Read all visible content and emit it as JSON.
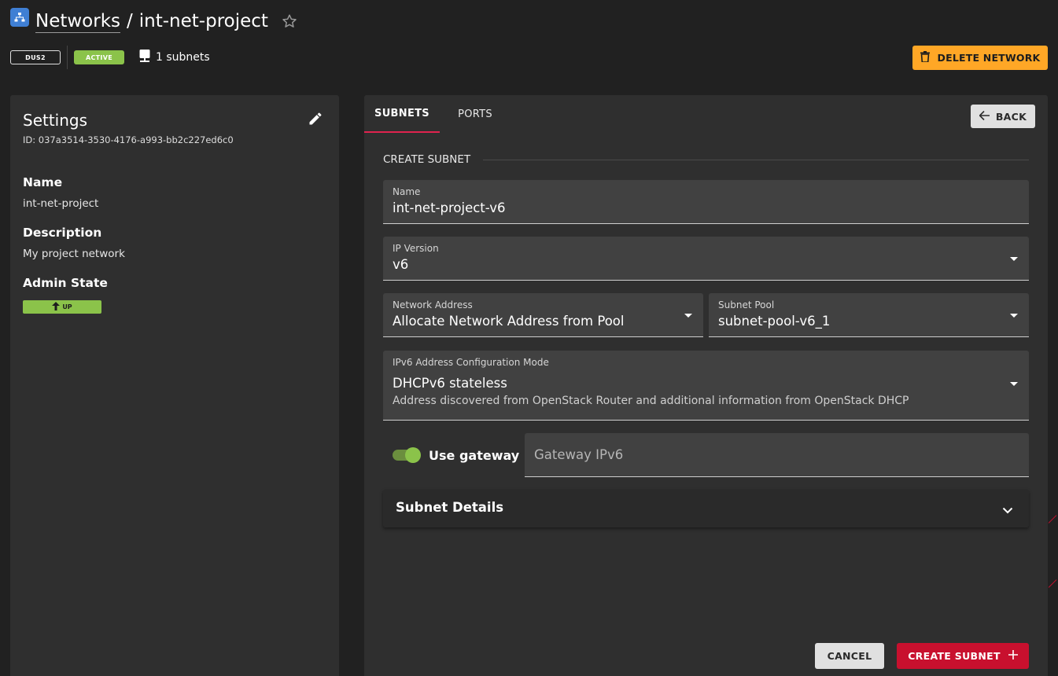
{
  "header": {
    "breadcrumb_parent": "Networks",
    "separator": "/",
    "title": "int-net-project",
    "region_badge": "DUS2",
    "status_badge": "ACTIVE",
    "subnets_count": "1 subnets",
    "delete_label": "DELETE NETWORK"
  },
  "settings": {
    "title": "Settings",
    "id_text": "ID: 037a3514-3530-4176-a993-bb2c227ed6c0",
    "name_label": "Name",
    "name_value": "int-net-project",
    "description_label": "Description",
    "description_value": "My project network",
    "admin_state_label": "Admin State",
    "admin_state_value": "UP"
  },
  "tabs": [
    {
      "label": "SUBNETS",
      "active": true
    },
    {
      "label": "PORTS",
      "active": false
    }
  ],
  "back_label": "BACK",
  "form": {
    "section_title": "CREATE SUBNET",
    "name": {
      "label": "Name",
      "value": "int-net-project-v6"
    },
    "ip_version": {
      "label": "IP Version",
      "value": "v6"
    },
    "network_address": {
      "label": "Network Address",
      "value": "Allocate Network Address from Pool"
    },
    "subnet_pool": {
      "label": "Subnet Pool",
      "value": "subnet-pool-v6_1"
    },
    "ipv6_mode": {
      "label": "IPv6 Address Configuration Mode",
      "value": "DHCPv6 stateless",
      "hint": "Address discovered from OpenStack Router and additional information from OpenStack DHCP"
    },
    "use_gateway": {
      "label": "Use gateway",
      "enabled": true
    },
    "gateway_placeholder": "Gateway IPv6",
    "details_title": "Subnet Details",
    "cancel_label": "CANCEL",
    "create_label": "CREATE SUBNET"
  },
  "colors": {
    "background": "#212121",
    "card": "#2f2f2f",
    "accent_red": "#c8102e",
    "status_green": "#8bc34a",
    "warning_orange": "#ffa726",
    "network_icon_blue": "#3f7fd4"
  }
}
